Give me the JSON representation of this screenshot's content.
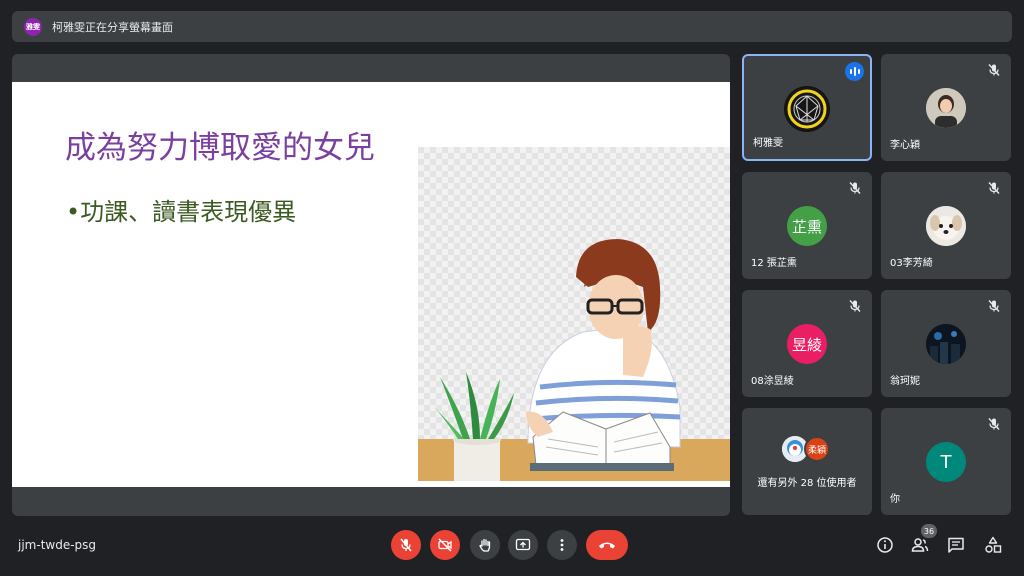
{
  "banner": {
    "avatar_text": "雅雯",
    "text": "柯雅雯正在分享螢幕畫面"
  },
  "slide": {
    "title": "成為努力博取愛的女兒",
    "bullet": "•功課、讀書表現優異"
  },
  "participants": [
    {
      "name": "柯雅雯",
      "avatar_kind": "logo",
      "speaking": true,
      "muted": false
    },
    {
      "name": "李心穎",
      "avatar_kind": "photo",
      "muted": true
    },
    {
      "name": "12 張芷熏",
      "avatar_text": "芷熏",
      "avatar_color": "#43a047",
      "muted": true
    },
    {
      "name": "03李芳綺",
      "avatar_kind": "photo",
      "muted": true
    },
    {
      "name": "08涂昱綾",
      "avatar_text": "昱綾",
      "avatar_color": "#e91e63",
      "muted": true
    },
    {
      "name": "翁珂妮",
      "avatar_kind": "photo",
      "muted": true
    },
    {
      "name": "你",
      "avatar_text": "T",
      "avatar_color": "#00897b",
      "muted": true
    }
  ],
  "more_tile": {
    "mini_avatar_text": "柔穎",
    "label": "還有另外 28 位使用者"
  },
  "bottom_bar": {
    "meeting_code": "jjm-twde-psg",
    "participant_count": "36",
    "controls": [
      "mic-off-icon",
      "camera-off-icon",
      "raise-hand-icon",
      "present-icon",
      "more-options-icon",
      "end-call-icon"
    ],
    "right_icons": [
      "info-icon",
      "people-icon",
      "chat-icon",
      "activities-icon"
    ]
  },
  "colors": {
    "background": "#202124",
    "tile": "#3c4043",
    "danger": "#ea4335",
    "active_border": "#8ab4f8"
  }
}
